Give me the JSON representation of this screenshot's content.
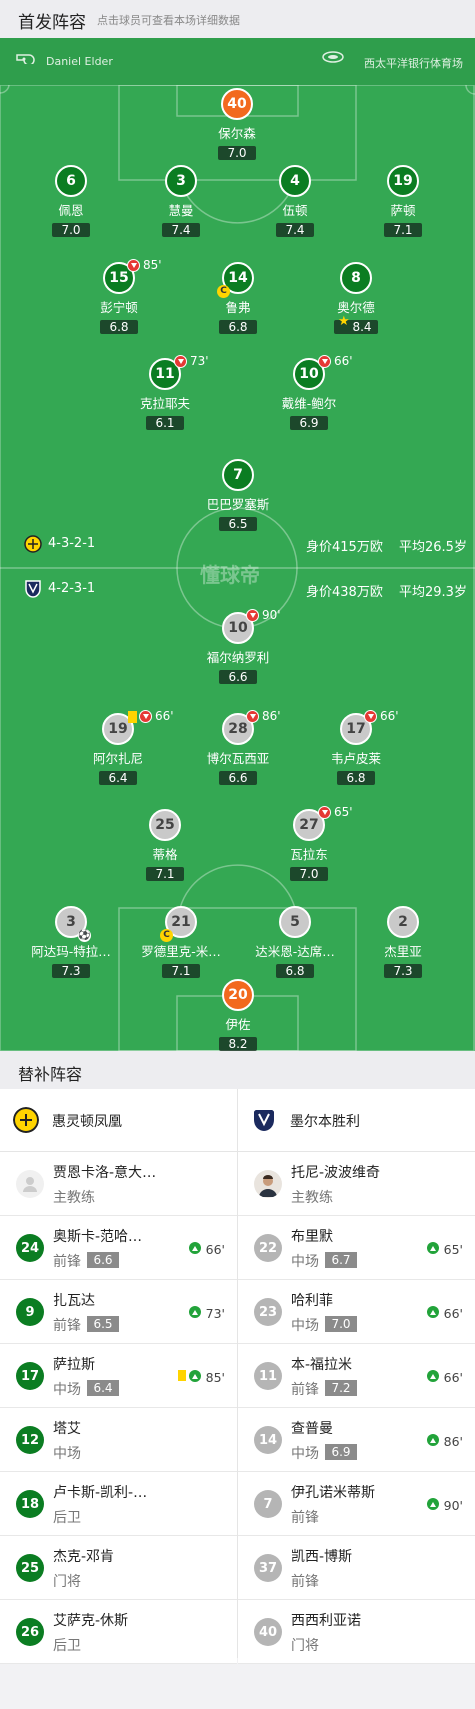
{
  "header": {
    "title": "首发阵容",
    "hint": "点击球员可查看本场详细数据"
  },
  "pitch": {
    "referee": "Daniel Elder",
    "venue": "西太平洋银行体育场",
    "watermark": "懂球帝"
  },
  "home": {
    "formation": "4-3-2-1",
    "value": "身价415万欧",
    "age": "平均26.5岁",
    "name": "惠灵顿凤凰"
  },
  "away": {
    "formation": "4-2-3-1",
    "value": "身价438万欧",
    "age": "平均29.3岁",
    "name": "墨尔本胜利"
  },
  "home_players": [
    {
      "num": "40",
      "name": "保尔森",
      "rating": "7.0"
    },
    {
      "num": "6",
      "name": "佩恩",
      "rating": "7.0"
    },
    {
      "num": "3",
      "name": "慧曼",
      "rating": "7.4"
    },
    {
      "num": "4",
      "name": "伍顿",
      "rating": "7.4"
    },
    {
      "num": "19",
      "name": "萨顿",
      "rating": "7.1"
    },
    {
      "num": "15",
      "name": "彭宁顿",
      "rating": "6.8",
      "sub": "85'"
    },
    {
      "num": "14",
      "name": "鲁弗",
      "rating": "6.8"
    },
    {
      "num": "8",
      "name": "奥尔德",
      "rating": "8.4"
    },
    {
      "num": "11",
      "name": "克拉耶夫",
      "rating": "6.1",
      "sub": "73'"
    },
    {
      "num": "10",
      "name": "戴维-鲍尔",
      "rating": "6.9",
      "sub": "66'"
    },
    {
      "num": "7",
      "name": "巴巴罗塞斯",
      "rating": "6.5"
    }
  ],
  "away_players": [
    {
      "num": "10",
      "name": "福尔纳罗利",
      "rating": "6.6",
      "sub": "90'"
    },
    {
      "num": "19",
      "name": "阿尔扎尼",
      "rating": "6.4",
      "sub": "66'"
    },
    {
      "num": "28",
      "name": "博尔瓦西亚",
      "rating": "6.6",
      "sub": "86'"
    },
    {
      "num": "17",
      "name": "韦卢皮莱",
      "rating": "6.8",
      "sub": "66'"
    },
    {
      "num": "25",
      "name": "蒂格",
      "rating": "7.1"
    },
    {
      "num": "27",
      "name": "瓦拉东",
      "rating": "7.0",
      "sub": "65'"
    },
    {
      "num": "3",
      "name": "阿达玛-特拉…",
      "rating": "7.3"
    },
    {
      "num": "21",
      "name": "罗德里克-米…",
      "rating": "7.1"
    },
    {
      "num": "5",
      "name": "达米恩-达席…",
      "rating": "6.8"
    },
    {
      "num": "2",
      "name": "杰里亚",
      "rating": "7.3"
    },
    {
      "num": "20",
      "name": "伊佐",
      "rating": "8.2"
    }
  ],
  "captain_mark": "C",
  "subs": {
    "title": "替补阵容",
    "home_coach": {
      "name": "贾恩卡洛-意大利诺",
      "role": "主教练"
    },
    "away_coach": {
      "name": "托尼-波波维奇",
      "role": "主教练"
    },
    "home": [
      {
        "num": "24",
        "name": "奥斯卡-范哈…",
        "pos": "前锋",
        "rating": "6.6",
        "in": "66'"
      },
      {
        "num": "9",
        "name": "扎瓦达",
        "pos": "前锋",
        "rating": "6.5",
        "in": "73'"
      },
      {
        "num": "17",
        "name": "萨拉斯",
        "pos": "中场",
        "rating": "6.4",
        "in": "85'"
      },
      {
        "num": "12",
        "name": "塔艾",
        "pos": "中场"
      },
      {
        "num": "18",
        "name": "卢卡斯-凯利-…",
        "pos": "后卫"
      },
      {
        "num": "25",
        "name": "杰克-邓肯",
        "pos": "门将"
      },
      {
        "num": "26",
        "name": "艾萨克-休斯",
        "pos": "后卫"
      }
    ],
    "away": [
      {
        "num": "22",
        "name": "布里默",
        "pos": "中场",
        "rating": "6.7",
        "in": "65'"
      },
      {
        "num": "23",
        "name": "哈利菲",
        "pos": "中场",
        "rating": "7.0",
        "in": "66'"
      },
      {
        "num": "11",
        "name": "本-福拉米",
        "pos": "前锋",
        "rating": "7.2",
        "in": "66'"
      },
      {
        "num": "14",
        "name": "查普曼",
        "pos": "中场",
        "rating": "6.9",
        "in": "86'"
      },
      {
        "num": "7",
        "name": "伊孔诺米蒂斯",
        "pos": "前锋",
        "in": "90'"
      },
      {
        "num": "37",
        "name": "凯西-博斯",
        "pos": "前锋"
      },
      {
        "num": "40",
        "name": "西西利亚诺",
        "pos": "门将"
      }
    ]
  },
  "colors": {
    "pitch": "#34a853",
    "home": "#0b7d22",
    "away": "#c9c9c9",
    "keeper": "#f2691e",
    "sub_out": "#e53935",
    "sub_in": "#22a33a"
  }
}
